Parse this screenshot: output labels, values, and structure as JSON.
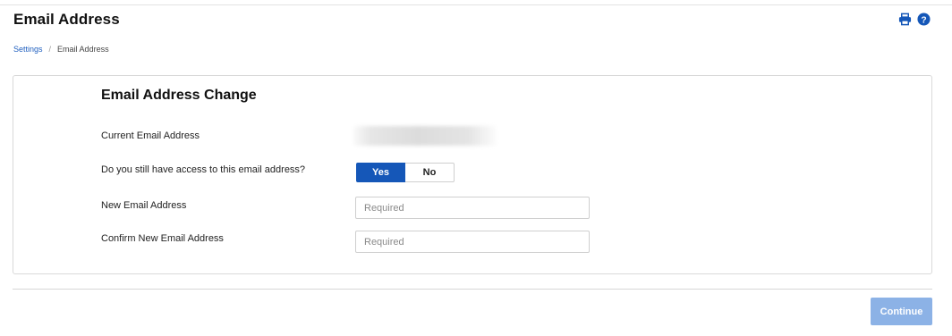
{
  "header": {
    "title": "Email Address",
    "icons": [
      "printer-icon",
      "help-icon"
    ]
  },
  "breadcrumb": {
    "items": [
      "Settings",
      "Email Address"
    ],
    "separator": "/"
  },
  "form": {
    "title": "Email Address Change",
    "current_email": {
      "label": "Current Email Address",
      "value_obscured": true
    },
    "access_question": {
      "label": "Do you still have access to this email address?",
      "options": [
        "Yes",
        "No"
      ],
      "selected": "Yes"
    },
    "new_email": {
      "label": "New Email Address",
      "placeholder": "Required",
      "value": ""
    },
    "confirm_email": {
      "label": "Confirm New Email Address",
      "placeholder": "Required",
      "value": ""
    }
  },
  "footer": {
    "continue_label": "Continue",
    "continue_enabled": false
  },
  "colors": {
    "primary": "#1557b8",
    "link": "#1f5fbf",
    "disabled_button": "#8cb2e6",
    "border": "#d9d9d9"
  }
}
